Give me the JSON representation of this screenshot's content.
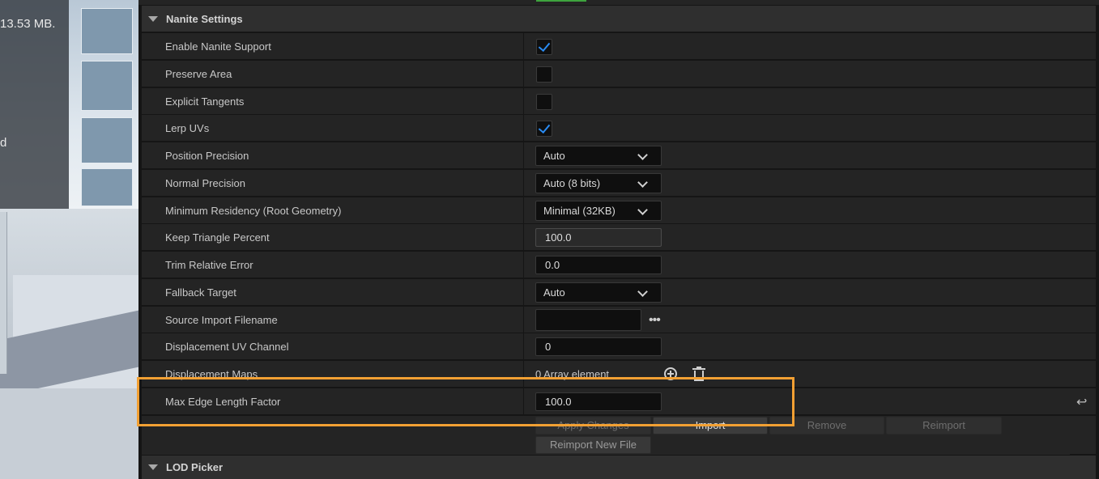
{
  "viewport": {
    "stat_line": "13.53 MB.",
    "stat_char": "d"
  },
  "sections": {
    "nanite": {
      "title": "Nanite Settings"
    },
    "lod": {
      "title": "LOD Picker"
    }
  },
  "rows": {
    "enable_nanite": {
      "label": "Enable Nanite Support",
      "checked": true
    },
    "preserve_area": {
      "label": "Preserve Area",
      "checked": false
    },
    "explicit_tangents": {
      "label": "Explicit Tangents",
      "checked": false
    },
    "lerp_uvs": {
      "label": "Lerp UVs",
      "checked": true
    },
    "position_precision": {
      "label": "Position Precision",
      "value": "Auto"
    },
    "normal_precision": {
      "label": "Normal Precision",
      "value": "Auto (8 bits)"
    },
    "min_residency": {
      "label": "Minimum Residency (Root Geometry)",
      "value": "Minimal (32KB)"
    },
    "keep_triangle": {
      "label": "Keep Triangle Percent",
      "value": "100.0"
    },
    "trim_error": {
      "label": "Trim Relative Error",
      "value": "0.0"
    },
    "fallback_target": {
      "label": "Fallback Target",
      "value": "Auto"
    },
    "source_import": {
      "label": "Source Import Filename",
      "value": "",
      "browse": "•••"
    },
    "disp_uv": {
      "label": "Displacement UV Channel",
      "value": "0"
    },
    "disp_maps": {
      "label": "Displacement Maps",
      "value": "0 Array element"
    },
    "max_edge": {
      "label": "Max Edge Length Factor",
      "value": "100.0"
    }
  },
  "buttons": {
    "apply": "Apply Changes",
    "import": "Import",
    "remove": "Remove",
    "reimport": "Reimport",
    "reimport_new": "Reimport New File"
  },
  "colors": {
    "highlight": "#f2a033",
    "checkbox_tick": "#2a8bf2"
  }
}
